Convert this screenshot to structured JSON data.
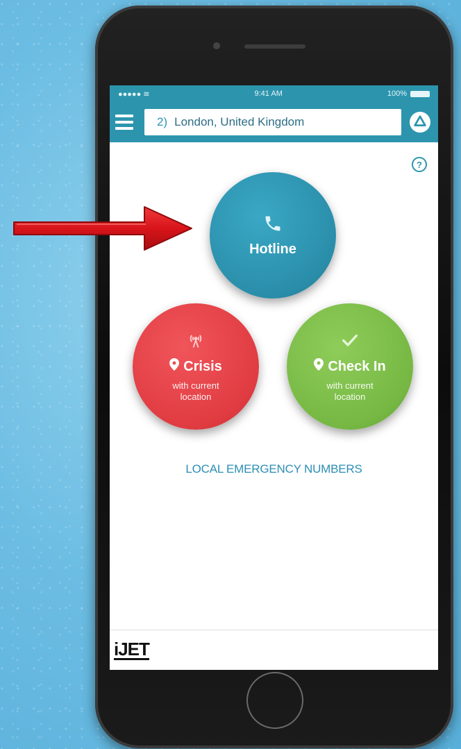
{
  "status_bar": {
    "signal": "●●●●● ≋",
    "time": "9:41 AM",
    "battery": "100%"
  },
  "header": {
    "location_index": "2)",
    "location": "London, United Kingdom"
  },
  "help": {
    "glyph": "?"
  },
  "actions": {
    "hotline": {
      "label": "Hotline"
    },
    "crisis": {
      "label": "Crisis",
      "subtitle_line1": "with current",
      "subtitle_line2": "location"
    },
    "checkin": {
      "label": "Check In",
      "subtitle_line1": "with current",
      "subtitle_line2": "location"
    }
  },
  "links": {
    "emergency_numbers": "LOCAL EMERGENCY NUMBERS"
  },
  "footer": {
    "logo": "iJET"
  },
  "colors": {
    "teal": "#2c95ad",
    "red": "#e03c42",
    "green": "#76b843",
    "arrow": "#d8141a"
  },
  "icons": [
    "menu-icon",
    "refresh-icon",
    "help-icon",
    "phone-icon",
    "broadcast-icon",
    "checkmark-icon",
    "location-pin-icon",
    "red-arrow-icon"
  ]
}
